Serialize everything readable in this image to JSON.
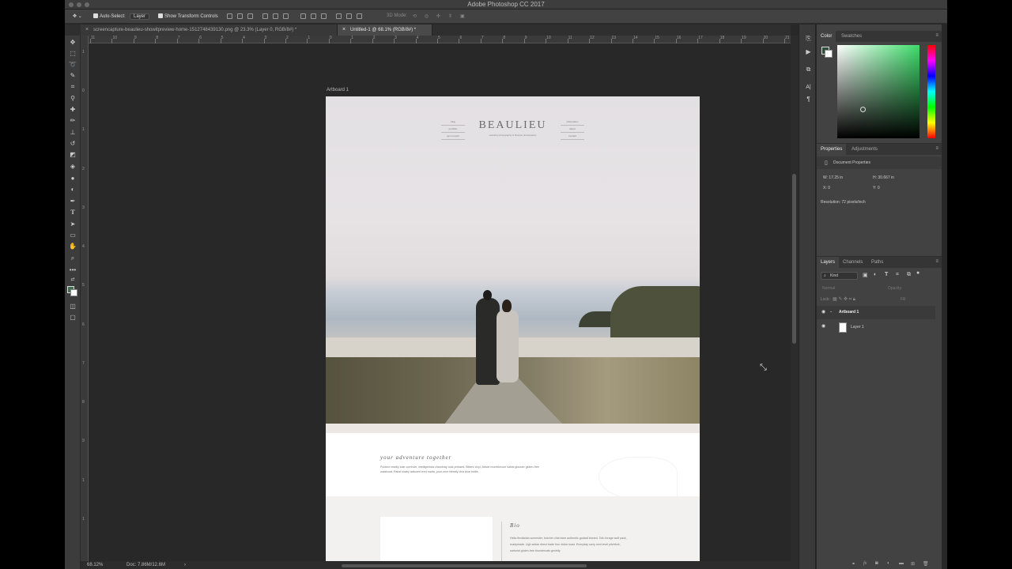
{
  "app": {
    "title": "Adobe Photoshop CC 2017"
  },
  "options_bar": {
    "auto_select_label": "Auto-Select:",
    "auto_select_value": "Layer",
    "transform_controls_label": "Show Transform Controls",
    "mode_3d_label": "3D Mode:"
  },
  "tabs": [
    {
      "label": "screencapture-beaulieu-showitpreview-home-1512748439130.png @ 23.3% (Layer 0, RGB/8#) *"
    },
    {
      "label": "Untitled-1 @ 68.1% (RGB/8#) *"
    }
  ],
  "ruler": {
    "h_numbers": [
      "11",
      "10",
      "9",
      "8",
      "7",
      "6",
      "5",
      "4",
      "3",
      "2",
      "1",
      "0",
      "1",
      "2",
      "3",
      "4",
      "5",
      "6",
      "7",
      "8",
      "9",
      "10",
      "11",
      "12",
      "13",
      "14",
      "15",
      "16",
      "17",
      "18",
      "19",
      "20",
      "21"
    ],
    "v_numbers": [
      "1",
      "0",
      "1",
      "2",
      "3",
      "4",
      "5",
      "6",
      "7",
      "8",
      "9",
      "1",
      "1"
    ]
  },
  "artboard": {
    "label": "Artboard 1",
    "logo": "BEAULIEU",
    "tagline": "wedding photography & lifestyle photography",
    "nav_left": [
      "blog",
      "portfolio",
      "get in touch"
    ],
    "nav_right": [
      "information",
      "about",
      "contact"
    ],
    "navbar_text": "· · ·",
    "adventure_title": "your adventure together",
    "adventure_text": "Poutine readily kale cornhole, intelligentsia chambray cold-pressed. Bitters vinyl, listicle mumblecore salvia glossier gluten-free waistcoat. Pabst shaby tattooed cred marfa, pour-over literally chia blue bottle.",
    "bio_title": "Bio",
    "bio_text": "Hella flexitarian scenester, butcher chia twee authentic godard leaned. Tofu forage wolf pack, readymade. Ugh seitan direct trade four dollar toast. Everyday carry next level pitchfork, sartorial gluten-free thundercats gentrify."
  },
  "status": {
    "zoom": "68.12%",
    "doc": "Doc: 7.86M/12.6M"
  },
  "color_panel": {
    "tabs": [
      "Color",
      "Swatches"
    ],
    "foreground": "#2f4f3a",
    "field_hue": "#3ddc6a"
  },
  "properties_panel": {
    "tabs": [
      "Properties",
      "Adjustments"
    ],
    "heading": "Document Properties",
    "w": "W:  17.25 in",
    "h": "H:  30.667 in",
    "x": "X:  0",
    "y": "Y:  0",
    "resolution": "Resolution: 72 pixels/inch"
  },
  "layers_panel": {
    "tabs": [
      "Layers",
      "Channels",
      "Paths"
    ],
    "filter": "Kind",
    "blend_mode": "Normal",
    "opacity_label": "Opacity:",
    "lock_label": "Lock:",
    "fill_label": "Fill:",
    "layers": [
      {
        "name": "Artboard 1",
        "type": "group"
      },
      {
        "name": "Layer 1",
        "type": "layer"
      }
    ]
  }
}
